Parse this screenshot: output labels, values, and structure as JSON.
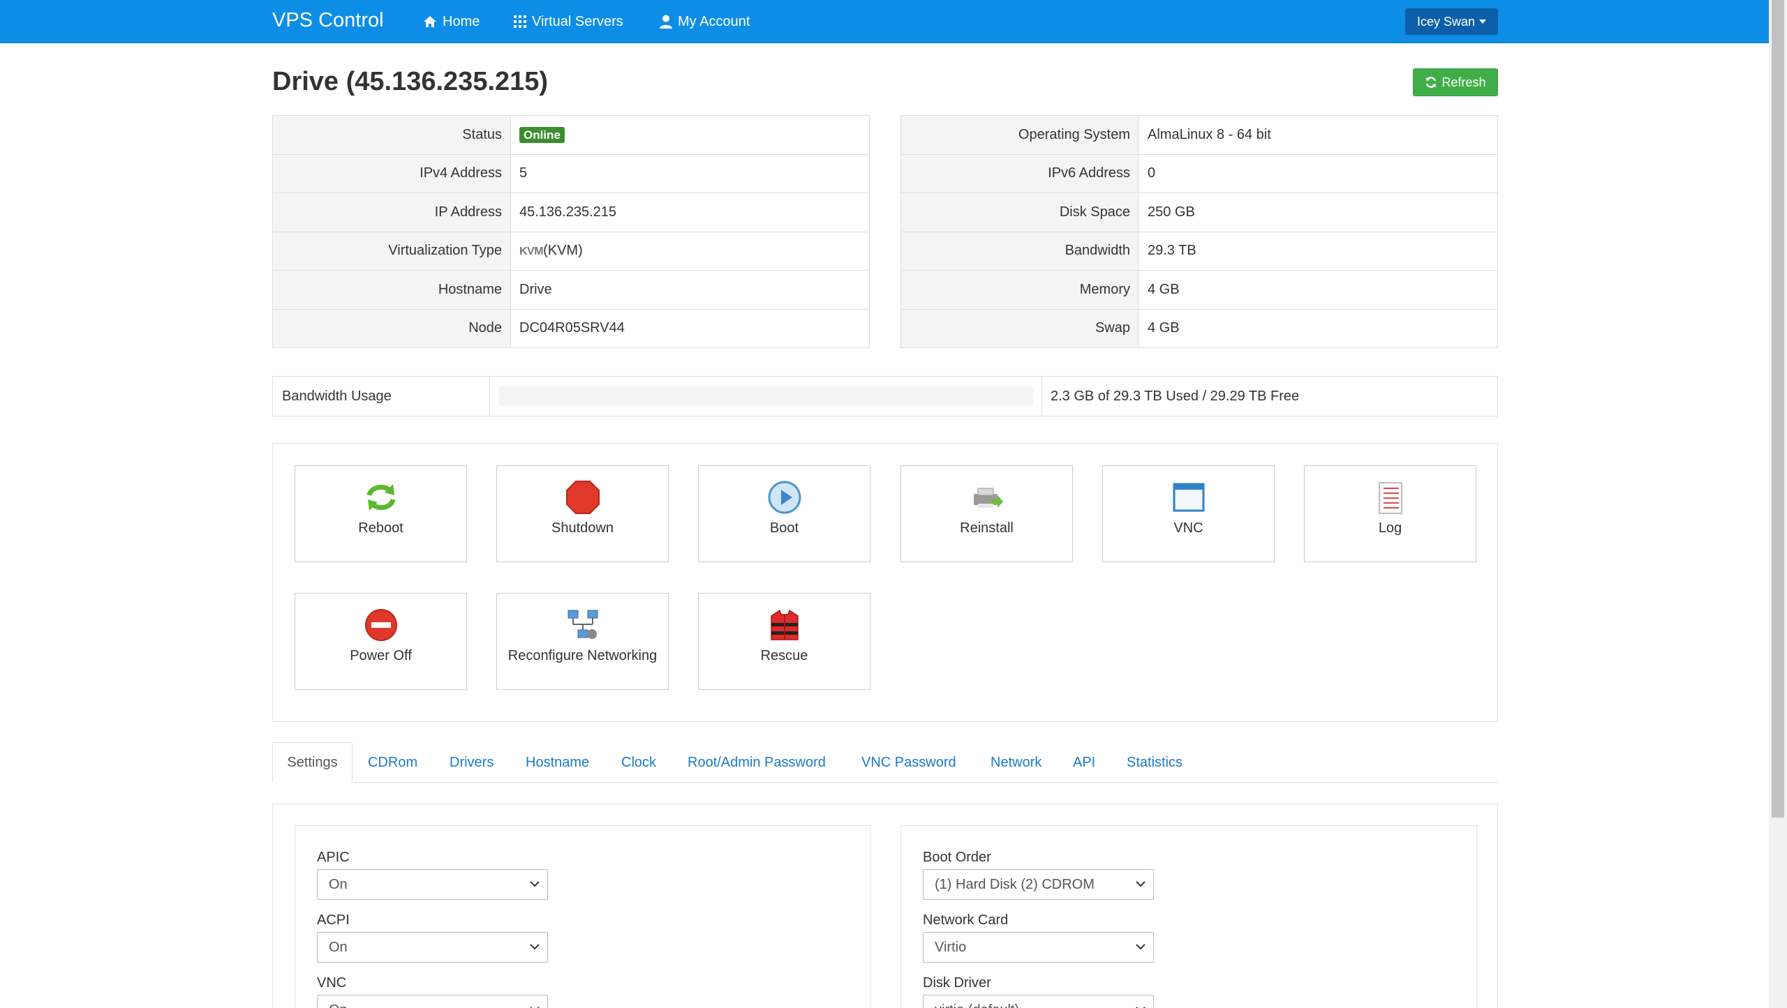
{
  "nav": {
    "brand": "VPS Control",
    "home": "Home",
    "virtual_servers": "Virtual Servers",
    "my_account": "My Account",
    "user": "Icey Swan",
    "accent_color": "#0d8ee6"
  },
  "page": {
    "title": "Drive (45.136.235.215)",
    "refresh": "Refresh"
  },
  "info_left": {
    "status_label": "Status",
    "status_value": "Online",
    "ipv4_label": "IPv4 Address",
    "ipv4_value": "5",
    "ip_label": "IP Address",
    "ip_value": "45.136.235.215",
    "virt_label": "Virtualization Type",
    "virt_logo": "KVM",
    "virt_value": "(KVM)",
    "hostname_label": "Hostname",
    "hostname_value": "Drive",
    "node_label": "Node",
    "node_value": "DC04R05SRV44"
  },
  "info_right": {
    "os_label": "Operating System",
    "os_value": "AlmaLinux 8 - 64 bit",
    "ipv6_label": "IPv6 Address",
    "ipv6_value": "0",
    "disk_label": "Disk Space",
    "disk_value": "250 GB",
    "bw_label": "Bandwidth",
    "bw_value": "29.3 TB",
    "mem_label": "Memory",
    "mem_value": "4 GB",
    "swap_label": "Swap",
    "swap_value": "4 GB"
  },
  "bandwidth_usage": {
    "label": "Bandwidth Usage",
    "used_fraction": 0.0001,
    "text": "2.3 GB of 29.3 TB Used / 29.29 TB Free"
  },
  "actions": [
    {
      "label": "Reboot",
      "icon": "reboot-icon"
    },
    {
      "label": "Shutdown",
      "icon": "stop-sign-icon"
    },
    {
      "label": "Boot",
      "icon": "play-icon"
    },
    {
      "label": "Reinstall",
      "icon": "printer-arrow-icon"
    },
    {
      "label": "VNC",
      "icon": "window-icon"
    },
    {
      "label": "Log",
      "icon": "notepad-icon"
    },
    {
      "label": "Power Off",
      "icon": "no-entry-icon"
    },
    {
      "label": "Reconfigure Networking",
      "icon": "network-icon"
    },
    {
      "label": "Rescue",
      "icon": "life-vest-icon"
    }
  ],
  "tabs": [
    "Settings",
    "CDRom",
    "Drivers",
    "Hostname",
    "Clock",
    "Root/Admin Password",
    "VNC Password",
    "Network",
    "API",
    "Statistics"
  ],
  "settings_left": {
    "apic_label": "APIC",
    "apic_value": "On",
    "acpi_label": "ACPI",
    "acpi_value": "On",
    "vnc_label": "VNC",
    "vnc_value": "On"
  },
  "settings_right": {
    "boot_label": "Boot Order",
    "boot_value": "(1) Hard Disk (2) CDROM",
    "nic_label": "Network Card",
    "nic_value": "Virtio",
    "disk_label": "Disk Driver",
    "disk_value": "virtio (default)"
  }
}
